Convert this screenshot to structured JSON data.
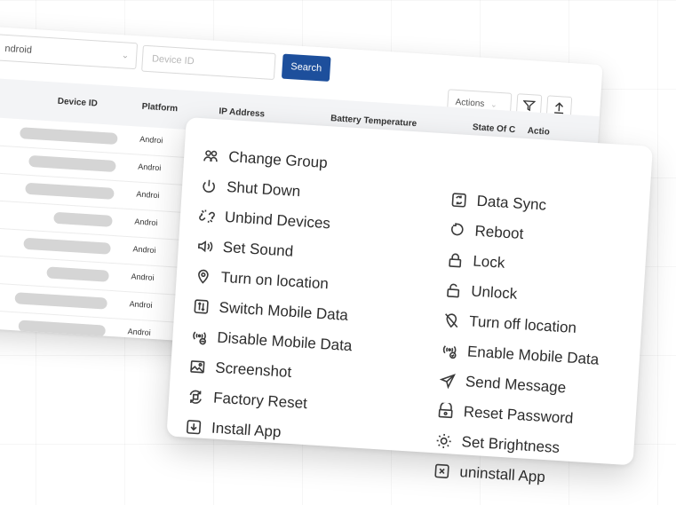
{
  "filters": {
    "platform_value": "ndroid",
    "device_id_placeholder": "Device ID",
    "search_label": "Search"
  },
  "toolbar": {
    "actions_label": "Actions"
  },
  "table": {
    "columns": [
      "Device ID",
      "Platform",
      "IP Address",
      "Battery Temperature",
      "State Of C",
      "Actio"
    ],
    "platform_cell": "Androi",
    "row_count": 8
  },
  "menu": {
    "left": [
      {
        "label": "Change Group",
        "icon": "users-group-icon"
      },
      {
        "label": "Shut Down",
        "icon": "power-icon"
      },
      {
        "label": "Unbind Devices",
        "icon": "unlink-icon"
      },
      {
        "label": "Set Sound",
        "icon": "speaker-icon"
      },
      {
        "label": "Turn on location",
        "icon": "location-pin-icon"
      },
      {
        "label": "Switch Mobile Data",
        "icon": "switch-data-icon"
      },
      {
        "label": "Disable Mobile Data",
        "icon": "disable-data-icon"
      },
      {
        "label": "Screenshot",
        "icon": "screenshot-icon"
      },
      {
        "label": "Factory Reset",
        "icon": "factory-reset-icon"
      },
      {
        "label": "Install App",
        "icon": "install-icon"
      }
    ],
    "right": [
      {
        "label": "Data Sync",
        "icon": "sync-icon"
      },
      {
        "label": "Reboot",
        "icon": "reboot-icon"
      },
      {
        "label": "Lock",
        "icon": "lock-icon"
      },
      {
        "label": "Unlock",
        "icon": "unlock-icon"
      },
      {
        "label": "Turn off location",
        "icon": "location-off-icon"
      },
      {
        "label": "Enable Mobile Data",
        "icon": "enable-data-icon"
      },
      {
        "label": "Send Message",
        "icon": "send-icon"
      },
      {
        "label": "Reset Password",
        "icon": "reset-password-icon"
      },
      {
        "label": "Set Brightness",
        "icon": "brightness-icon"
      },
      {
        "label": "uninstall App",
        "icon": "uninstall-icon"
      }
    ]
  }
}
